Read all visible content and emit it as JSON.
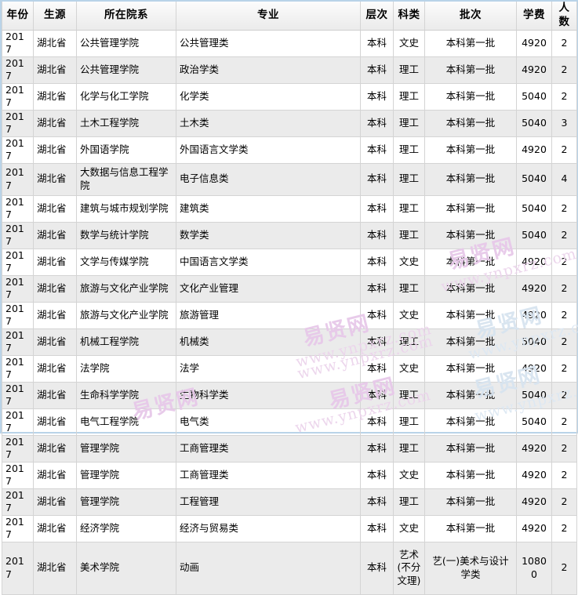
{
  "table": {
    "headers": [
      {
        "key": "year",
        "label": "年份"
      },
      {
        "key": "src",
        "label": "生源"
      },
      {
        "key": "dept",
        "label": "所在院系"
      },
      {
        "key": "major",
        "label": "专业"
      },
      {
        "key": "level",
        "label": "层次"
      },
      {
        "key": "cat",
        "label": "科类"
      },
      {
        "key": "batch",
        "label": "批次"
      },
      {
        "key": "fee",
        "label": "学费"
      },
      {
        "key": "num",
        "label": "人数"
      }
    ],
    "rows": [
      {
        "year": "2017",
        "src": "湖北省",
        "dept": "公共管理学院",
        "major": "公共管理类",
        "level": "本科",
        "cat": "文史",
        "batch": "本科第一批",
        "fee": "4920",
        "num": "2",
        "height": "normal"
      },
      {
        "year": "2017",
        "src": "湖北省",
        "dept": "公共管理学院",
        "major": "政治学类",
        "level": "本科",
        "cat": "理工",
        "batch": "本科第一批",
        "fee": "4920",
        "num": "2",
        "height": "normal"
      },
      {
        "year": "2017",
        "src": "湖北省",
        "dept": "化学与化工学院",
        "major": "化学类",
        "level": "本科",
        "cat": "理工",
        "batch": "本科第一批",
        "fee": "5040",
        "num": "2",
        "height": "normal"
      },
      {
        "year": "2017",
        "src": "湖北省",
        "dept": "土木工程学院",
        "major": "土木类",
        "level": "本科",
        "cat": "理工",
        "batch": "本科第一批",
        "fee": "5040",
        "num": "3",
        "height": "normal"
      },
      {
        "year": "2017",
        "src": "湖北省",
        "dept": "外国语学院",
        "major": "外国语言文学类",
        "level": "本科",
        "cat": "理工",
        "batch": "本科第一批",
        "fee": "4920",
        "num": "2",
        "height": "normal"
      },
      {
        "year": "2017",
        "src": "湖北省",
        "dept": "大数据与信息工程学院",
        "major": "电子信息类",
        "level": "本科",
        "cat": "理工",
        "batch": "本科第一批",
        "fee": "5040",
        "num": "4",
        "height": "tall"
      },
      {
        "year": "2017",
        "src": "湖北省",
        "dept": "建筑与城市规划学院",
        "major": "建筑类",
        "level": "本科",
        "cat": "理工",
        "batch": "本科第一批",
        "fee": "5040",
        "num": "2",
        "height": "normal"
      },
      {
        "year": "2017",
        "src": "湖北省",
        "dept": "数学与统计学院",
        "major": "数学类",
        "level": "本科",
        "cat": "理工",
        "batch": "本科第一批",
        "fee": "5040",
        "num": "2",
        "height": "normal"
      },
      {
        "year": "2017",
        "src": "湖北省",
        "dept": "文学与传媒学院",
        "major": "中国语言文学类",
        "level": "本科",
        "cat": "文史",
        "batch": "本科第一批",
        "fee": "4920",
        "num": "2",
        "height": "normal"
      },
      {
        "year": "2017",
        "src": "湖北省",
        "dept": "旅游与文化产业学院",
        "major": "文化产业管理",
        "level": "本科",
        "cat": "理工",
        "batch": "本科第一批",
        "fee": "4920",
        "num": "2",
        "height": "normal"
      },
      {
        "year": "2017",
        "src": "湖北省",
        "dept": "旅游与文化产业学院",
        "major": "旅游管理",
        "level": "本科",
        "cat": "文史",
        "batch": "本科第一批",
        "fee": "4920",
        "num": "2",
        "height": "normal"
      },
      {
        "year": "2017",
        "src": "湖北省",
        "dept": "机械工程学院",
        "major": "机械类",
        "level": "本科",
        "cat": "理工",
        "batch": "本科第一批",
        "fee": "5040",
        "num": "2",
        "height": "normal"
      },
      {
        "year": "2017",
        "src": "湖北省",
        "dept": "法学院",
        "major": "法学",
        "level": "本科",
        "cat": "文史",
        "batch": "本科第一批",
        "fee": "4920",
        "num": "2",
        "height": "normal"
      },
      {
        "year": "2017",
        "src": "湖北省",
        "dept": "生命科学学院",
        "major": "生物科学类",
        "level": "本科",
        "cat": "理工",
        "batch": "本科第一批",
        "fee": "5040",
        "num": "2",
        "height": "normal"
      },
      {
        "year": "2017",
        "src": "湖北省",
        "dept": "电气工程学院",
        "major": "电气类",
        "level": "本科",
        "cat": "理工",
        "batch": "本科第一批",
        "fee": "5040",
        "num": "2",
        "height": "normal"
      },
      {
        "year": "2017",
        "src": "湖北省",
        "dept": "管理学院",
        "major": "工商管理类",
        "level": "本科",
        "cat": "理工",
        "batch": "本科第一批",
        "fee": "4920",
        "num": "2",
        "height": "normal"
      },
      {
        "year": "2017",
        "src": "湖北省",
        "dept": "管理学院",
        "major": "工商管理类",
        "level": "本科",
        "cat": "文史",
        "batch": "本科第一批",
        "fee": "4920",
        "num": "2",
        "height": "normal"
      },
      {
        "year": "2017",
        "src": "湖北省",
        "dept": "管理学院",
        "major": "工程管理",
        "level": "本科",
        "cat": "理工",
        "batch": "本科第一批",
        "fee": "4920",
        "num": "2",
        "height": "normal"
      },
      {
        "year": "2017",
        "src": "湖北省",
        "dept": "经济学院",
        "major": "经济与贸易类",
        "level": "本科",
        "cat": "文史",
        "batch": "本科第一批",
        "fee": "4920",
        "num": "2",
        "height": "normal"
      },
      {
        "year": "2017",
        "src": "湖北省",
        "dept": "美术学院",
        "major": "动画",
        "level": "本科",
        "cat": "艺术(不分文理)",
        "batch": "艺(一)美术与设计学类",
        "fee": "10800",
        "num": "2",
        "height": "xtall"
      }
    ]
  },
  "watermarks": {
    "site_cn": "易贤网",
    "site_url": "www.ynpxrz.com"
  },
  "colors": {
    "border_outer": "#b9d3e8",
    "border_cell": "#d4d4d4",
    "header_bg": "#f0f0f0",
    "alt_row_bg": "#ebebeb",
    "text": "#000000",
    "watermark_pink": "#e7c9e9",
    "watermark_gray": "#d9d9d9",
    "watermark_blue": "#d8e4f0"
  }
}
